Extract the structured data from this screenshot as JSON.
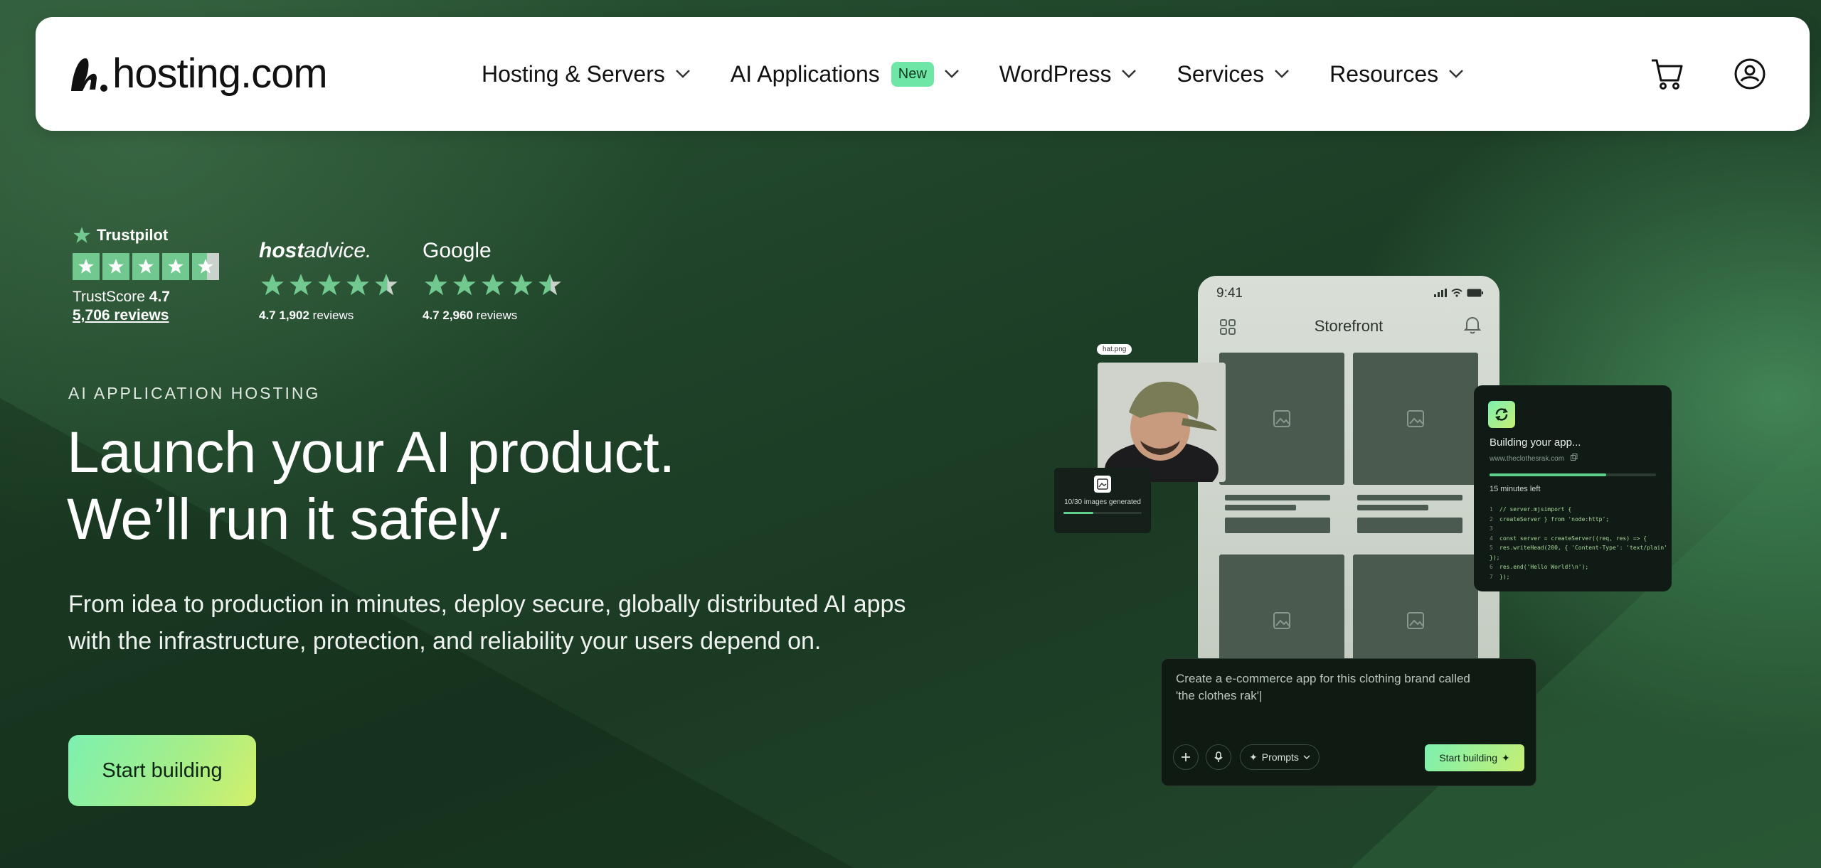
{
  "nav": {
    "logo_text": "hosting.com",
    "menu": [
      {
        "label": "Hosting & Servers"
      },
      {
        "label": "AI Applications",
        "badge": "New"
      },
      {
        "label": "WordPress"
      },
      {
        "label": "Services"
      },
      {
        "label": "Resources"
      }
    ],
    "icons": [
      "cart-icon",
      "account-icon"
    ]
  },
  "ratings": {
    "trustpilot": {
      "brand": "Trustpilot",
      "score_label": "TrustScore",
      "score": "4.7",
      "reviews": "5,706 reviews",
      "stars": 4.5
    },
    "hostadvice": {
      "brand_bold": "host",
      "brand_rest": "advice.",
      "rating": "4.7",
      "count": "1,902",
      "reviews_word": "reviews",
      "stars": 4.5
    },
    "google": {
      "brand": "Google",
      "rating": "4.7",
      "count": "2,960",
      "reviews_word": "reviews",
      "stars": 4.5
    }
  },
  "hero": {
    "eyebrow": "AI APPLICATION HOSTING",
    "headline_line1": "Launch your AI product.",
    "headline_line2": "We’ll run it safely.",
    "subtext": "From idea to production in minutes, deploy secure, globally distributed AI apps with the infrastructure, protection, and reliability your users depend on.",
    "cta": "Start building"
  },
  "mockup": {
    "time": "9:41",
    "app_title": "Storefront",
    "file_tag": "hat.png",
    "images_generated": "10/30 images generated",
    "build_title": "Building your app...",
    "build_url": "www.theclothesrak.com",
    "build_progress": 0.7,
    "time_left": "15 minutes left",
    "code_lines": [
      "// server.mjsimport {",
      "createServer } from 'node:http';",
      "",
      "const server = createServer((req, res) => {",
      "res.writeHead(200, { 'Content-Type': 'text/plain' });",
      "res.end('Hello World!\\n');",
      "});"
    ],
    "prompt_text": "Create a e-commerce app for this clothing brand called 'the clothes rak'|",
    "prompts_label": "Prompts",
    "start_small": "Start building"
  },
  "colors": {
    "accent_green": "#7cf0b0",
    "accent_lime": "#d4f06a",
    "star_green": "#71c98f",
    "bg_dark": "#1b3a24"
  }
}
